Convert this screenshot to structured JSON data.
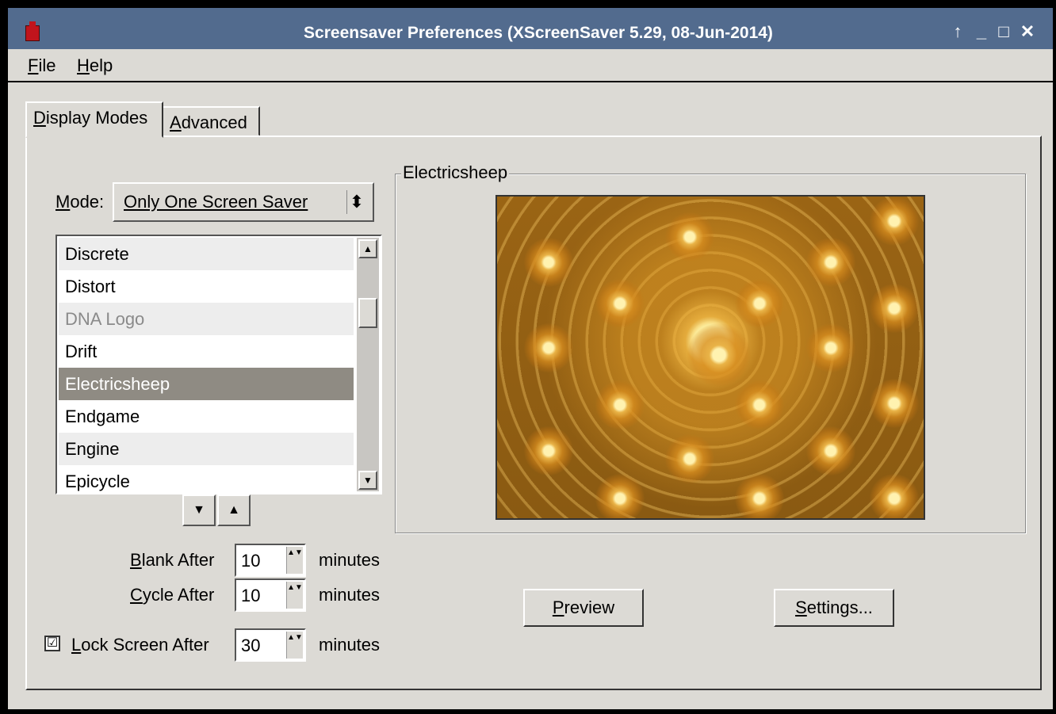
{
  "window": {
    "title": "Screensaver Preferences  (XScreenSaver 5.29, 08-Jun-2014)",
    "controls": [
      "↑",
      "_",
      "□",
      "✕"
    ]
  },
  "menu": {
    "file": {
      "accel": "F",
      "rest": "ile"
    },
    "help": {
      "accel": "H",
      "rest": "elp"
    }
  },
  "tabs": {
    "display_modes": {
      "accel": "D",
      "rest": "isplay Modes"
    },
    "advanced": {
      "accel": "A",
      "rest": "dvanced"
    }
  },
  "mode": {
    "label_accel": "M",
    "label_rest": "ode:",
    "selected": "Only One Screen Saver",
    "arrows": "⬍"
  },
  "screensaver_list": [
    {
      "name": "Discrete",
      "state": "alt"
    },
    {
      "name": "Distort",
      "state": "normal"
    },
    {
      "name": "DNA Logo",
      "state": "dim"
    },
    {
      "name": "Drift",
      "state": "normal"
    },
    {
      "name": "Electricsheep",
      "state": "selected"
    },
    {
      "name": "Endgame",
      "state": "normal"
    },
    {
      "name": "Engine",
      "state": "alt"
    },
    {
      "name": "Epicycle",
      "state": "normal"
    }
  ],
  "move_buttons": {
    "down": "▼",
    "up": "▲"
  },
  "timing": {
    "blank": {
      "accel": "B",
      "rest": "lank After",
      "value": "10",
      "unit": "minutes"
    },
    "cycle": {
      "accel": "C",
      "rest": "ycle After",
      "value": "10",
      "unit": "minutes"
    },
    "lock": {
      "accel": "L",
      "rest": "ock Screen After",
      "value": "30",
      "unit": "minutes",
      "checked": "☑"
    }
  },
  "preview_frame": {
    "title": "Electricsheep"
  },
  "buttons": {
    "preview": {
      "accel": "P",
      "rest": "review"
    },
    "settings": {
      "accel": "S",
      "rest": "ettings..."
    }
  },
  "icons": {
    "spin": "▲▼",
    "scroll_up": "▲",
    "scroll_down": "▼"
  }
}
